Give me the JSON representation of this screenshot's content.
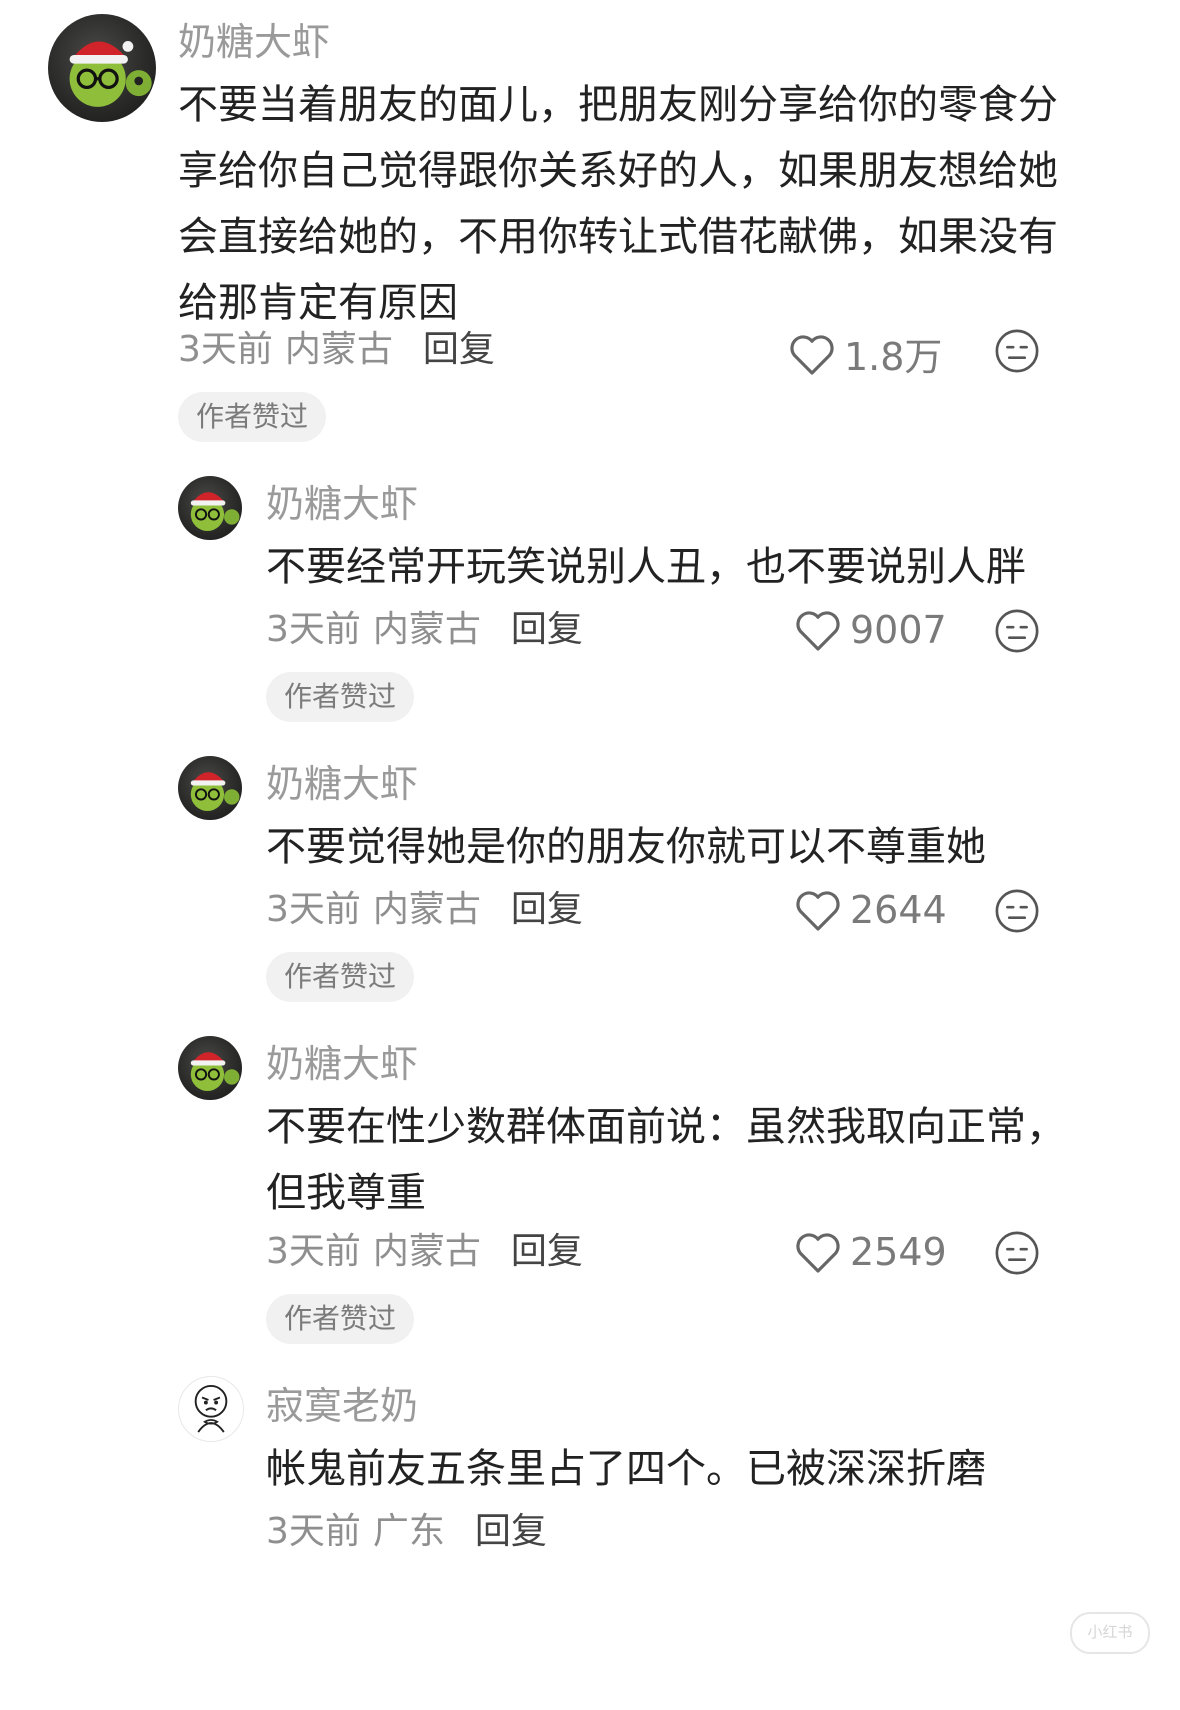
{
  "comments": [
    {
      "username": "奶糖大虾",
      "lines": [
        "不要当着朋友的面儿，把朋友刚分享给你的零食分",
        "享给你自己觉得跟你关系好的人，如果朋友想给她",
        "会直接给她的，不用你转让式借花献佛，如果没有",
        "给那肯定有原因"
      ],
      "time": "3天前",
      "location": "内蒙古",
      "reply_label": "回复",
      "likes": "1.8万",
      "badge": "作者赞过",
      "avatar_icon": "alien-santa-avatar"
    },
    {
      "username": "奶糖大虾",
      "lines": [
        "不要经常开玩笑说别人丑，也不要说别人胖"
      ],
      "time": "3天前",
      "location": "内蒙古",
      "reply_label": "回复",
      "likes": "9007",
      "badge": "作者赞过",
      "avatar_icon": "alien-santa-avatar"
    },
    {
      "username": "奶糖大虾",
      "lines": [
        "不要觉得她是你的朋友你就可以不尊重她"
      ],
      "time": "3天前",
      "location": "内蒙古",
      "reply_label": "回复",
      "likes": "2644",
      "badge": "作者赞过",
      "avatar_icon": "alien-santa-avatar"
    },
    {
      "username": "奶糖大虾",
      "lines": [
        "不要在性少数群体面前说：虽然我取向正常，",
        "但我尊重"
      ],
      "time": "3天前",
      "location": "内蒙古",
      "reply_label": "回复",
      "likes": "2549",
      "badge": "作者赞过",
      "avatar_icon": "alien-santa-avatar"
    },
    {
      "username": "寂寞老奶",
      "lines": [
        "帐鬼前友五条里占了四个。已被深深折磨"
      ],
      "time": "3天前",
      "location": "广东",
      "reply_label": "回复",
      "avatar_icon": "meme-face-avatar"
    }
  ],
  "watermark": "小红书",
  "icons": {
    "like": "heart-outline-icon",
    "dislike": "neutral-face-icon"
  }
}
